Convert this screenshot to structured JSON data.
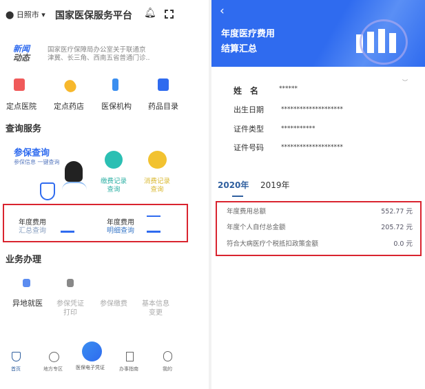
{
  "left": {
    "city": "日照市",
    "title": "国家医保服务平台",
    "news": {
      "badge_line1": "新闻",
      "badge_line2": "动态",
      "text_line1": "国家医疗保障局办公室关于联通京",
      "text_line2": "津冀、长三角、西南五省普通门诊.."
    },
    "quick": [
      {
        "label": "定点医院",
        "color": "#f05a5a"
      },
      {
        "label": "定点药店",
        "color": "#f7b82c"
      },
      {
        "label": "医保机构",
        "color": "#3a8ef0"
      },
      {
        "label": "药品目录",
        "color": "#2f6bef"
      }
    ],
    "query_section": "查询服务",
    "insurance_query": {
      "title": "参保查询",
      "subtitle": "参保信息 一键查询"
    },
    "payment_record": {
      "line1": "缴费记录",
      "line2": "查询",
      "color": "#2bbfb3"
    },
    "consume_record": {
      "line1": "消费记录",
      "line2": "查询",
      "color": "#f2c230"
    },
    "annual_summary": {
      "line1": "年度费用",
      "line2": "汇总查询"
    },
    "annual_detail": {
      "line1": "年度费用",
      "line2": "明细查询"
    },
    "business_section": "业务办理",
    "business": [
      {
        "line1": "异地就医",
        "line2": ""
      },
      {
        "line1": "参保凭证",
        "line2": "打印"
      },
      {
        "line1": "参保缴费",
        "line2": ""
      },
      {
        "line1": "基本信息",
        "line2": "变更"
      }
    ],
    "nav": [
      {
        "label": "首页"
      },
      {
        "label": "地方专区"
      },
      {
        "label": "医保电子凭证"
      },
      {
        "label": "办事指南"
      },
      {
        "label": "我的"
      }
    ]
  },
  "right": {
    "header_line1": "年度医疗费用",
    "header_line2": "结算汇总",
    "info": [
      {
        "label": "姓　名",
        "value": "******"
      },
      {
        "label": "出生日期",
        "value": "********************"
      },
      {
        "label": "证件类型",
        "value": "***********"
      },
      {
        "label": "证件号码",
        "value": "********************"
      }
    ],
    "tabs": [
      {
        "label": "2020年",
        "active": true
      },
      {
        "label": "2019年",
        "active": false
      }
    ],
    "rows": [
      {
        "label": "年度费用总额",
        "value": "552.77 元"
      },
      {
        "label": "年度个人自付总金额",
        "value": "205.72 元"
      },
      {
        "label": "符合大病医疗个税抵扣政策金额",
        "value": "0.0 元"
      }
    ]
  },
  "colors": {
    "blue": "#2f6bef",
    "highlight": "#d9232e"
  }
}
